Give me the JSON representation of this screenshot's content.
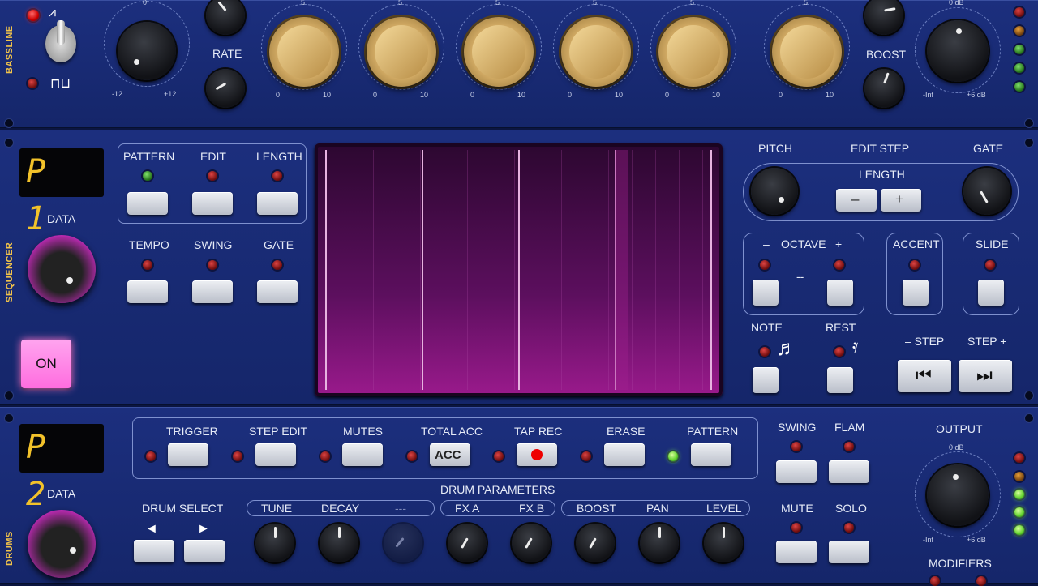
{
  "bassline": {
    "label": "BASSLINE",
    "rate_label": "RATE",
    "tune_min": "-12",
    "tune_max": "+12",
    "brass_top": "5",
    "brass_min": "0",
    "brass_max": "10",
    "boost_label": "BOOST",
    "out_top": "0 dB",
    "out_min": "-Inf",
    "out_max": "+6 dB",
    "top_tick": "0"
  },
  "sequencer": {
    "label": "SEQUENCER",
    "display": "P 1",
    "data_label": "DATA",
    "on_label": "ON",
    "buttons": {
      "pattern": "PATTERN",
      "edit": "EDIT",
      "length": "LENGTH",
      "tempo": "TEMPO",
      "swing": "SWING",
      "gate": "GATE"
    },
    "right": {
      "pitch": "PITCH",
      "edit_step": "EDIT STEP",
      "gate": "GATE",
      "length": "LENGTH",
      "minus": "–",
      "plus": "+",
      "octave_minus": "–",
      "octave": "OCTAVE",
      "octave_plus": "+",
      "octave_value": "--",
      "accent": "ACCENT",
      "slide": "SLIDE",
      "note": "NOTE",
      "rest": "REST",
      "step_back": "– STEP",
      "step_fwd": "STEP +"
    }
  },
  "drums": {
    "label": "DRUMS",
    "display": "P 2",
    "data_label": "DATA",
    "top_buttons": [
      "TRIGGER",
      "STEP EDIT",
      "MUTES",
      "TOTAL ACC",
      "TAP REC",
      "ERASE",
      "PATTERN"
    ],
    "acc_label": "ACC",
    "swing": "SWING",
    "flam": "FLAM",
    "mute": "MUTE",
    "solo": "SOLO",
    "output": "OUTPUT",
    "out_top": "0 dB",
    "out_min": "-Inf",
    "out_max": "+6 dB",
    "modifiers": "MODIFIERS",
    "drum_params": "DRUM  PARAMETERS",
    "drum_select": "DRUM   SELECT",
    "params": [
      "TUNE",
      "DECAY",
      "---",
      "FX A",
      "FX B",
      "BOOST",
      "PAN",
      "LEVEL"
    ]
  },
  "colors": {
    "accent_gold": "#f0c24a",
    "on_button": "#ff7fe6",
    "screen": "#3a0a3c"
  }
}
